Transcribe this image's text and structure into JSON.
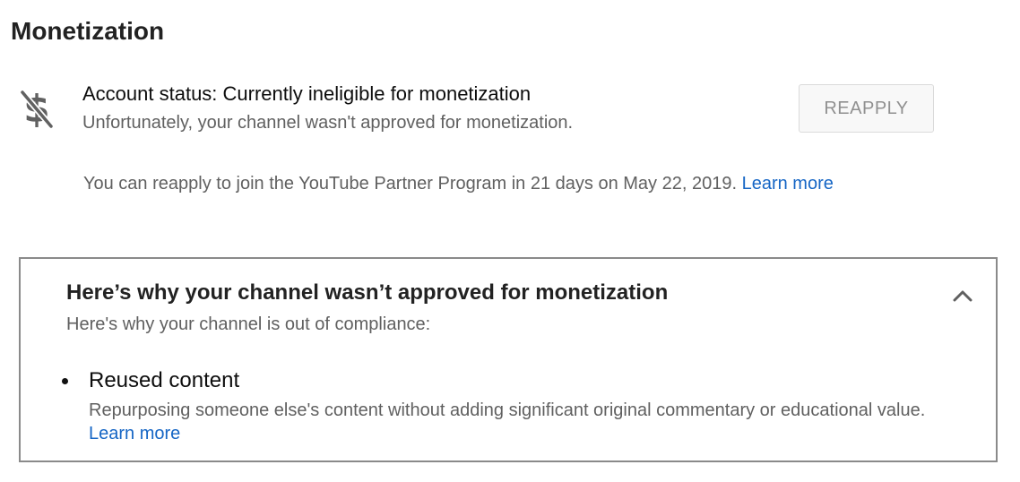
{
  "page": {
    "title": "Monetization"
  },
  "account_status": {
    "icon": "no-money-icon",
    "title": "Account status: Currently ineligible for monetization",
    "subtitle": "Unfortunately, your channel wasn't approved for monetization.",
    "reapply_button_label": "REAPPLY",
    "reapply_note": "You can reapply to join the YouTube Partner Program in 21 days on May 22, 2019.",
    "learn_more_label": "Learn more"
  },
  "reason_panel": {
    "title": "Here’s why your channel wasn’t approved for monetization",
    "subtitle": "Here's why your channel is out of compliance:",
    "toggle_icon": "chevron-up-icon",
    "reasons": [
      {
        "title": "Reused content",
        "description": "Repurposing someone else's content without adding significant original commentary or educational value.",
        "learn_more_label": "Learn more"
      }
    ]
  },
  "colors": {
    "link": "#1666c5",
    "secondary_text": "#606060",
    "panel_border": "#8a8a8a"
  }
}
